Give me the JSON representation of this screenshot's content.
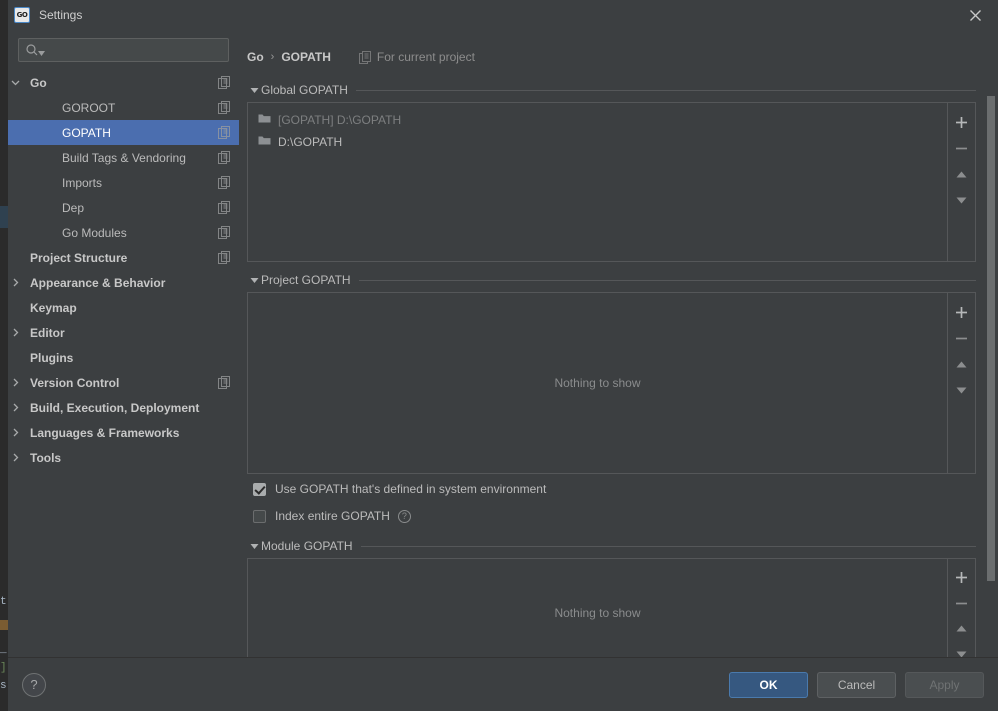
{
  "window": {
    "title": "Settings",
    "logo_text": "GO",
    "close_icon": "close-icon"
  },
  "search": {
    "value": "",
    "placeholder": "",
    "icon": "search-icon"
  },
  "sidebar": {
    "items": [
      {
        "label": "Go",
        "depth": 0,
        "arrow": "expanded",
        "bold": true,
        "selected": false,
        "project_icon": true
      },
      {
        "label": "GOROOT",
        "depth": 1,
        "arrow": "none",
        "bold": false,
        "selected": false,
        "project_icon": true
      },
      {
        "label": "GOPATH",
        "depth": 1,
        "arrow": "none",
        "bold": false,
        "selected": true,
        "project_icon": true
      },
      {
        "label": "Build Tags & Vendoring",
        "depth": 1,
        "arrow": "none",
        "bold": false,
        "selected": false,
        "project_icon": true
      },
      {
        "label": "Imports",
        "depth": 1,
        "arrow": "none",
        "bold": false,
        "selected": false,
        "project_icon": true
      },
      {
        "label": "Dep",
        "depth": 1,
        "arrow": "none",
        "bold": false,
        "selected": false,
        "project_icon": true
      },
      {
        "label": "Go Modules",
        "depth": 1,
        "arrow": "none",
        "bold": false,
        "selected": false,
        "project_icon": true
      },
      {
        "label": "Project Structure",
        "depth": 0,
        "arrow": "none",
        "bold": true,
        "selected": false,
        "project_icon": true
      },
      {
        "label": "Appearance & Behavior",
        "depth": 0,
        "arrow": "collapsed",
        "bold": true,
        "selected": false,
        "project_icon": false
      },
      {
        "label": "Keymap",
        "depth": 0,
        "arrow": "none",
        "bold": true,
        "selected": false,
        "project_icon": false
      },
      {
        "label": "Editor",
        "depth": 0,
        "arrow": "collapsed",
        "bold": true,
        "selected": false,
        "project_icon": false
      },
      {
        "label": "Plugins",
        "depth": 0,
        "arrow": "none",
        "bold": true,
        "selected": false,
        "project_icon": false
      },
      {
        "label": "Version Control",
        "depth": 0,
        "arrow": "collapsed",
        "bold": true,
        "selected": false,
        "project_icon": true
      },
      {
        "label": "Build, Execution, Deployment",
        "depth": 0,
        "arrow": "collapsed",
        "bold": true,
        "selected": false,
        "project_icon": false
      },
      {
        "label": "Languages & Frameworks",
        "depth": 0,
        "arrow": "collapsed",
        "bold": true,
        "selected": false,
        "project_icon": false
      },
      {
        "label": "Tools",
        "depth": 0,
        "arrow": "collapsed",
        "bold": true,
        "selected": false,
        "project_icon": false
      }
    ]
  },
  "breadcrumb": {
    "parent": "Go",
    "separator": "›",
    "current": "GOPATH",
    "scope_note": "For current project",
    "scope_icon": "project-scope-icon"
  },
  "sections": {
    "global_gopath": {
      "title": "Global GOPATH",
      "collapsed": false,
      "items": [
        {
          "text": "[GOPATH] D:\\GOPATH",
          "dim": true
        },
        {
          "text": "D:\\GOPATH",
          "dim": false
        }
      ],
      "empty_text": "",
      "toolbar": [
        "add-icon",
        "remove-icon",
        "move-up-icon",
        "move-down-icon"
      ]
    },
    "project_gopath": {
      "title": "Project GOPATH",
      "collapsed": false,
      "items": [],
      "empty_text": "Nothing to show",
      "toolbar": [
        "add-icon",
        "remove-icon",
        "move-up-icon",
        "move-down-icon"
      ]
    },
    "module_gopath": {
      "title": "Module GOPATH",
      "collapsed": false,
      "items": [],
      "empty_text": "Nothing to show",
      "toolbar": [
        "add-icon",
        "remove-icon",
        "move-up-icon",
        "move-down-icon"
      ]
    }
  },
  "options": [
    {
      "label": "Use GOPATH that's defined in system environment",
      "checked": true,
      "help": false
    },
    {
      "label": "Index entire GOPATH",
      "checked": false,
      "help": true,
      "help_glyph": "?"
    }
  ],
  "footer": {
    "help_label": "?",
    "ok_label": "OK",
    "cancel_label": "Cancel",
    "apply_label": "Apply",
    "apply_disabled": true
  },
  "backdrop": {
    "code_lines": [
      "t",
      "",
      "",
      "_",
      "]",
      "s"
    ]
  },
  "colors": {
    "window_bg": "#3c3f41",
    "selection_blue": "#4b6eaf",
    "primary_button": "#365880",
    "text": "#bbbbbb",
    "dim_text": "#7d7f80",
    "border": "#555759"
  }
}
